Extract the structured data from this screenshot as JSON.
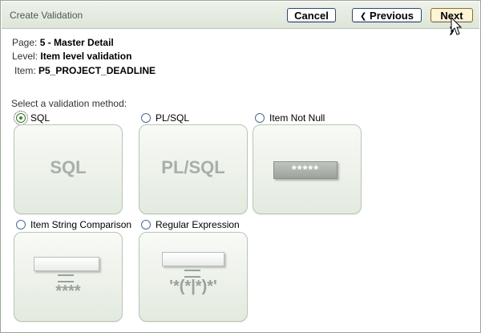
{
  "header": {
    "title": "Create Validation",
    "cancel_label": "Cancel",
    "previous_label": "Previous",
    "next_label": "Next"
  },
  "info": {
    "page_label": "Page:",
    "page_value": "5 - Master Detail",
    "level_label": "Level:",
    "level_value": "Item level validation",
    "item_label": "Item:",
    "item_value": "P5_PROJECT_DEADLINE"
  },
  "select_label": "Select a validation method:",
  "methods": [
    {
      "label": "SQL",
      "selected": true,
      "tile_text": "SQL"
    },
    {
      "label": "PL/SQL",
      "selected": false,
      "tile_text": "PL/SQL"
    },
    {
      "label": "Item Not Null",
      "selected": false,
      "tile_text": "*****"
    },
    {
      "label": "Item String Comparison",
      "selected": false,
      "tile_text": "****"
    },
    {
      "label": "Regular Expression",
      "selected": false,
      "tile_text": "'*(*|*)*'"
    }
  ],
  "colors": {
    "header_bg": "#dde5d8",
    "tile_bg": "#eef2ea",
    "radio_selected": "#2f8a2f"
  },
  "icons": {
    "chevron_left": "chevron-left-icon",
    "chevron_right": "chevron-right-icon",
    "cursor": "mouse-pointer-icon"
  }
}
